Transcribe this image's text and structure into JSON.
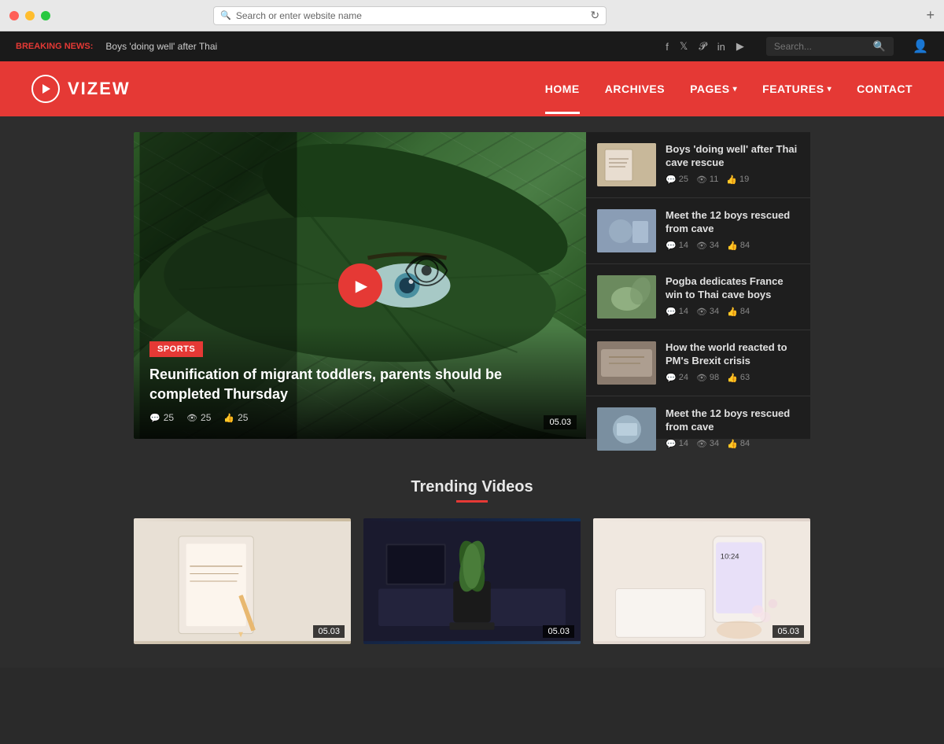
{
  "browser": {
    "address": "Search or enter website name",
    "refresh_icon": "↻",
    "plus_icon": "+"
  },
  "topbar": {
    "breaking_label": "BREAKING NEWS:",
    "breaking_text": "Boys 'doing well' after Thai",
    "search_placeholder": "Search...",
    "social": {
      "facebook": "f",
      "twitter": "t",
      "pinterest": "p",
      "linkedin": "in",
      "youtube": "▶"
    }
  },
  "header": {
    "logo_text": "VIZEW",
    "nav": [
      {
        "label": "HOME",
        "active": true
      },
      {
        "label": "ARCHIVES",
        "active": false
      },
      {
        "label": "PAGES",
        "has_dropdown": true
      },
      {
        "label": "FEATURES",
        "has_dropdown": true
      },
      {
        "label": "CONTACT",
        "active": false
      }
    ]
  },
  "hero": {
    "category": "SPORTS",
    "title": "Reunification of migrant toddlers, parents should be completed Thursday",
    "comments": "25",
    "views": "25",
    "likes": "25",
    "date": "05.03"
  },
  "sidebar_news": [
    {
      "title": "Boys 'doing well' after Thai cave rescue",
      "comments": "25",
      "views": "11",
      "likes": "19"
    },
    {
      "title": "Meet the 12 boys rescued from cave",
      "comments": "14",
      "views": "34",
      "likes": "84"
    },
    {
      "title": "Pogba dedicates France win to Thai cave boys",
      "comments": "14",
      "views": "34",
      "likes": "84"
    },
    {
      "title": "How the world reacted to PM's Brexit crisis",
      "comments": "24",
      "views": "98",
      "likes": "63"
    },
    {
      "title": "Meet the 12 boys rescued from cave",
      "comments": "14",
      "views": "34",
      "likes": "84"
    }
  ],
  "trending": {
    "section_title": "Trending Videos",
    "videos": [
      {
        "date": "05.03"
      },
      {
        "date": "05.03"
      },
      {
        "date": "05.03"
      }
    ]
  },
  "colors": {
    "accent": "#e53935",
    "bg_dark": "#2d2d2d",
    "bg_darker": "#1e1e1e",
    "text_light": "#e0e0e0",
    "text_muted": "#888888"
  }
}
